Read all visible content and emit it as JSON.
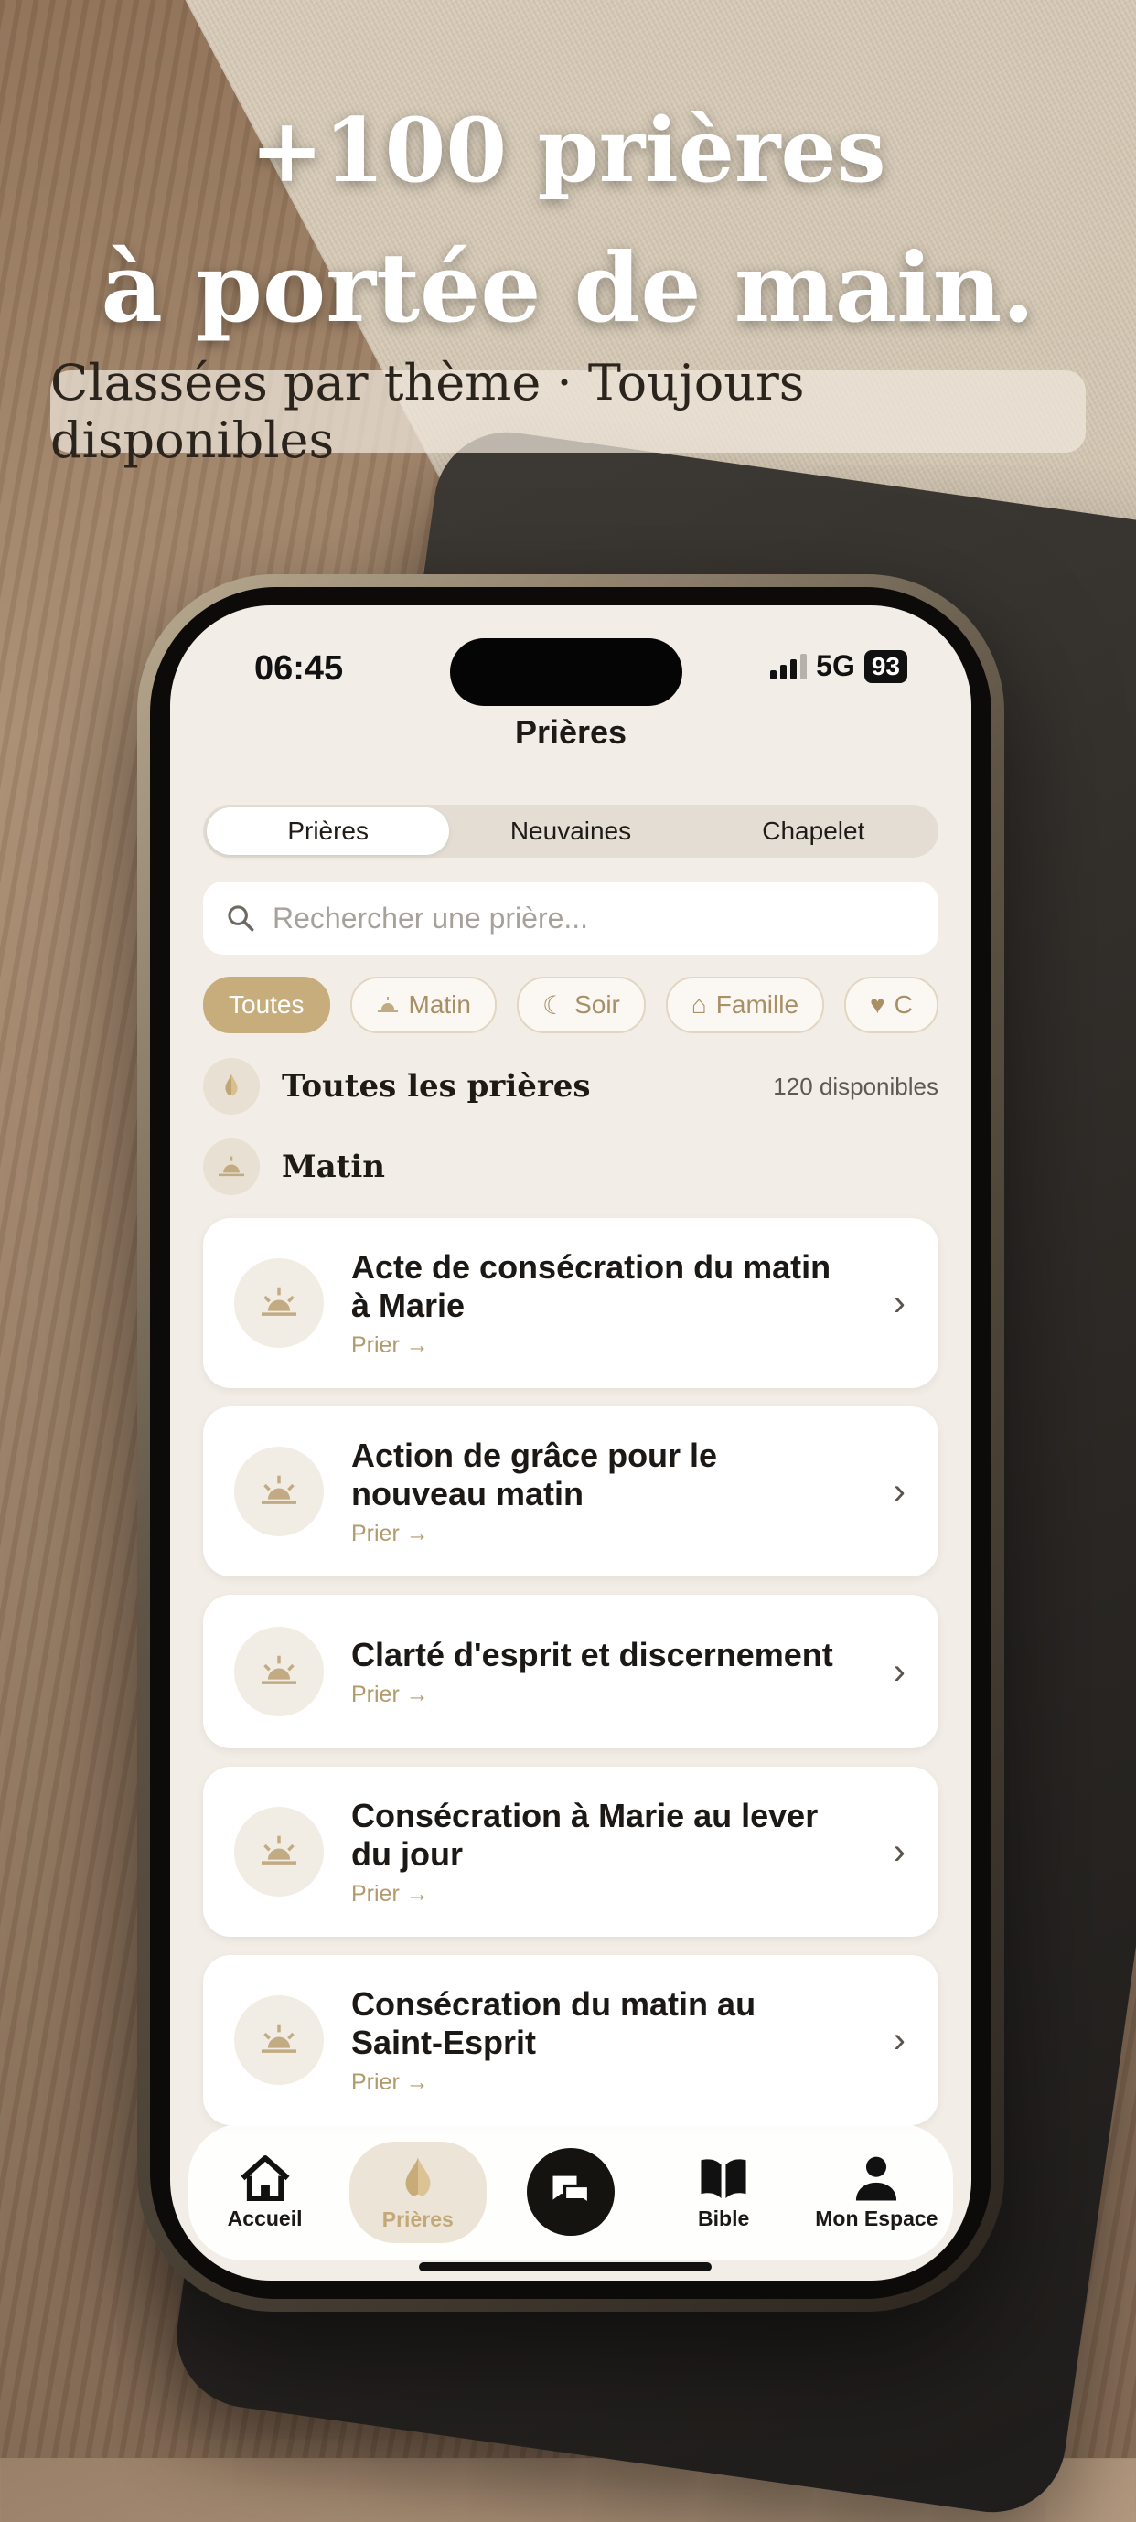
{
  "promo": {
    "headline_line1": "+100 prières",
    "headline_line2": "à portée de main.",
    "subtitle": "Classées par thème · Toujours disponibles"
  },
  "status_bar": {
    "time": "06:45",
    "network": "5G",
    "battery": "93"
  },
  "screen": {
    "title": "Prières",
    "segments": [
      {
        "label": "Prières",
        "active": true
      },
      {
        "label": "Neuvaines",
        "active": false
      },
      {
        "label": "Chapelet",
        "active": false
      }
    ],
    "search": {
      "placeholder": "Rechercher une prière..."
    },
    "chips": [
      {
        "label": "Toutes",
        "icon": "none",
        "active": true
      },
      {
        "label": "Matin",
        "icon": "sunrise-icon"
      },
      {
        "label": "Soir",
        "icon": "moon-icon"
      },
      {
        "label": "Famille",
        "icon": "house-icon"
      },
      {
        "label": "C",
        "icon": "heart-icon"
      }
    ],
    "all_section": {
      "label": "Toutes les prières",
      "count": "120 disponibles",
      "icon": "praying-hands-icon"
    },
    "morning_section": {
      "label": "Matin",
      "icon": "sunrise-icon"
    },
    "prayers": [
      {
        "title_line1": "Acte de consécration du matin",
        "title_line2": "à Marie",
        "action": "Prier →"
      },
      {
        "title_line1": "Action de grâce pour le",
        "title_line2": "nouveau matin",
        "action": "Prier →"
      },
      {
        "title_line1": "Clarté d'esprit et discernement",
        "title_line2": "",
        "action": "Prier →"
      },
      {
        "title_line1": "Consécration à Marie au lever",
        "title_line2": "du jour",
        "action": "Prier →"
      },
      {
        "title_line1": "Consécration du matin au",
        "title_line2": "Saint-Esprit",
        "action": "Prier →"
      }
    ],
    "tabbar": [
      {
        "label": "Accueil",
        "icon": "home-icon"
      },
      {
        "label": "Prières",
        "icon": "praying-hands-icon",
        "active": true
      },
      {
        "label": "",
        "icon": "chat-icon"
      },
      {
        "label": "Bible",
        "icon": "book-icon"
      },
      {
        "label": "Mon Espace",
        "icon": "person-icon"
      }
    ]
  },
  "colors": {
    "accent": "#c7ad7c",
    "background": "#f2ede6",
    "card": "#ffffff"
  }
}
